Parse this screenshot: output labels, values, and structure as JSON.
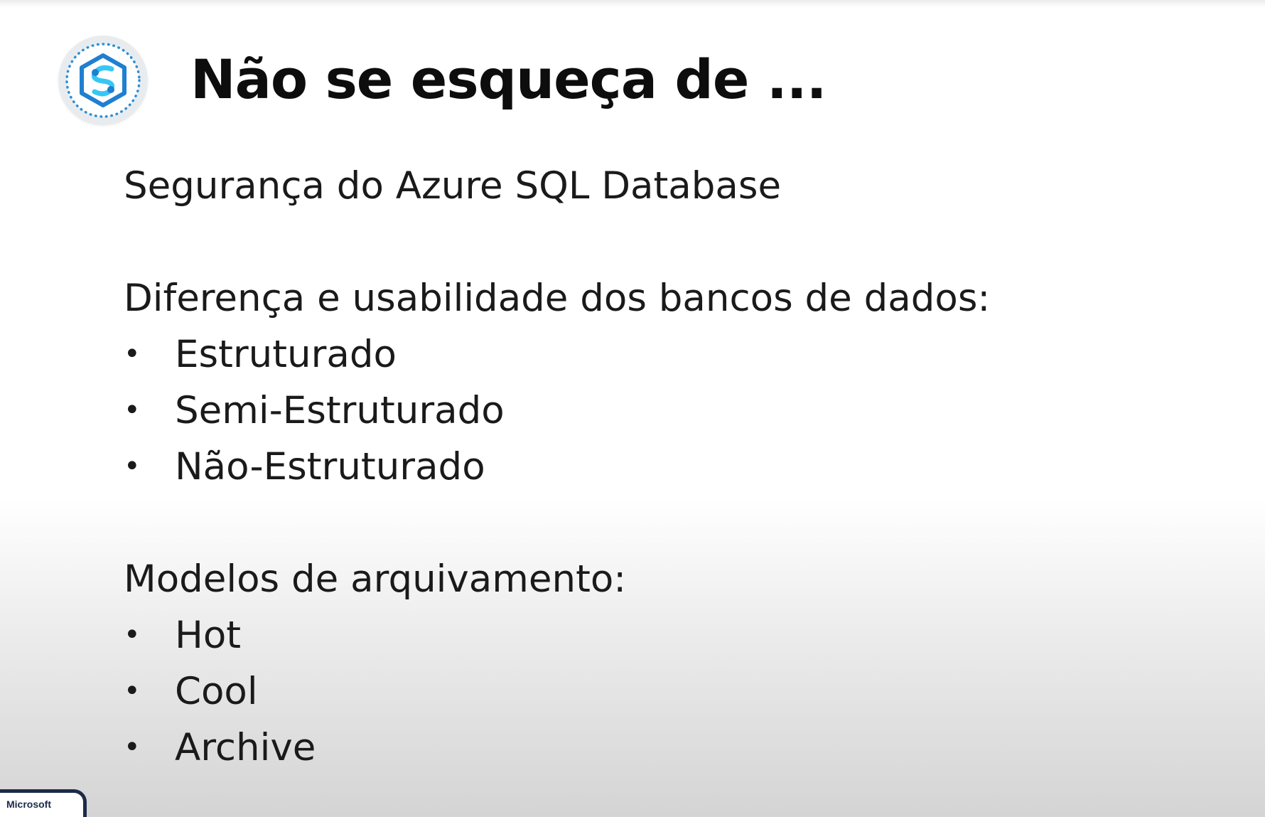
{
  "slide": {
    "title": "Não se esqueça de ...",
    "logo_icon": "azure-synapse-hexagon-icon",
    "accent_color": "#1f9cd8"
  },
  "content": {
    "line1": "Segurança do Azure SQL Database",
    "section_databases": {
      "heading": "Diferença e usabilidade dos bancos de dados:",
      "items": [
        "Estruturado",
        "Semi-Estruturado",
        "Não-Estruturado"
      ]
    },
    "section_archiving": {
      "heading": "Modelos de arquivamento:",
      "items": [
        "Hot",
        "Cool",
        "Archive"
      ]
    },
    "bullet_glyph": "•"
  },
  "badge": {
    "label": "Microsoft"
  }
}
